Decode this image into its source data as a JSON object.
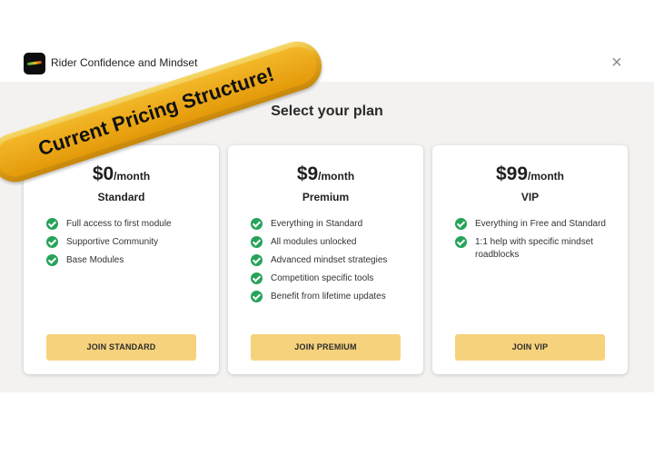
{
  "header": {
    "app_title": "Rider Confidence and Mindset",
    "close_symbol": "×"
  },
  "main": {
    "title": "Select your plan"
  },
  "plans": [
    {
      "price": "$0",
      "period": "/month",
      "name": "Standard",
      "features": [
        "Full access to first module",
        "Supportive Community",
        "Base Modules"
      ],
      "button": "JOIN STANDARD"
    },
    {
      "price": "$9",
      "period": "/month",
      "name": "Premium",
      "features": [
        "Everything in Standard",
        "All modules unlocked",
        "Advanced mindset strategies",
        "Competition specific tools",
        "Benefit from lifetime updates"
      ],
      "button": "JOIN PREMIUM"
    },
    {
      "price": "$99",
      "period": "/month",
      "name": "VIP",
      "features": [
        "Everything in Free and Standard",
        "1:1 help with specific mindset roadblocks"
      ],
      "button": "JOIN VIP"
    }
  ],
  "banner": {
    "text": "Current Pricing Structure!"
  },
  "icons": {
    "check": "check-circle-icon",
    "close": "close-icon",
    "logo": "app-logo-icon"
  },
  "colors": {
    "accent_button": "#f6d27c",
    "check_green": "#27a35a",
    "banner_gold": "#e2a81a",
    "background": "#f3f2f0"
  }
}
